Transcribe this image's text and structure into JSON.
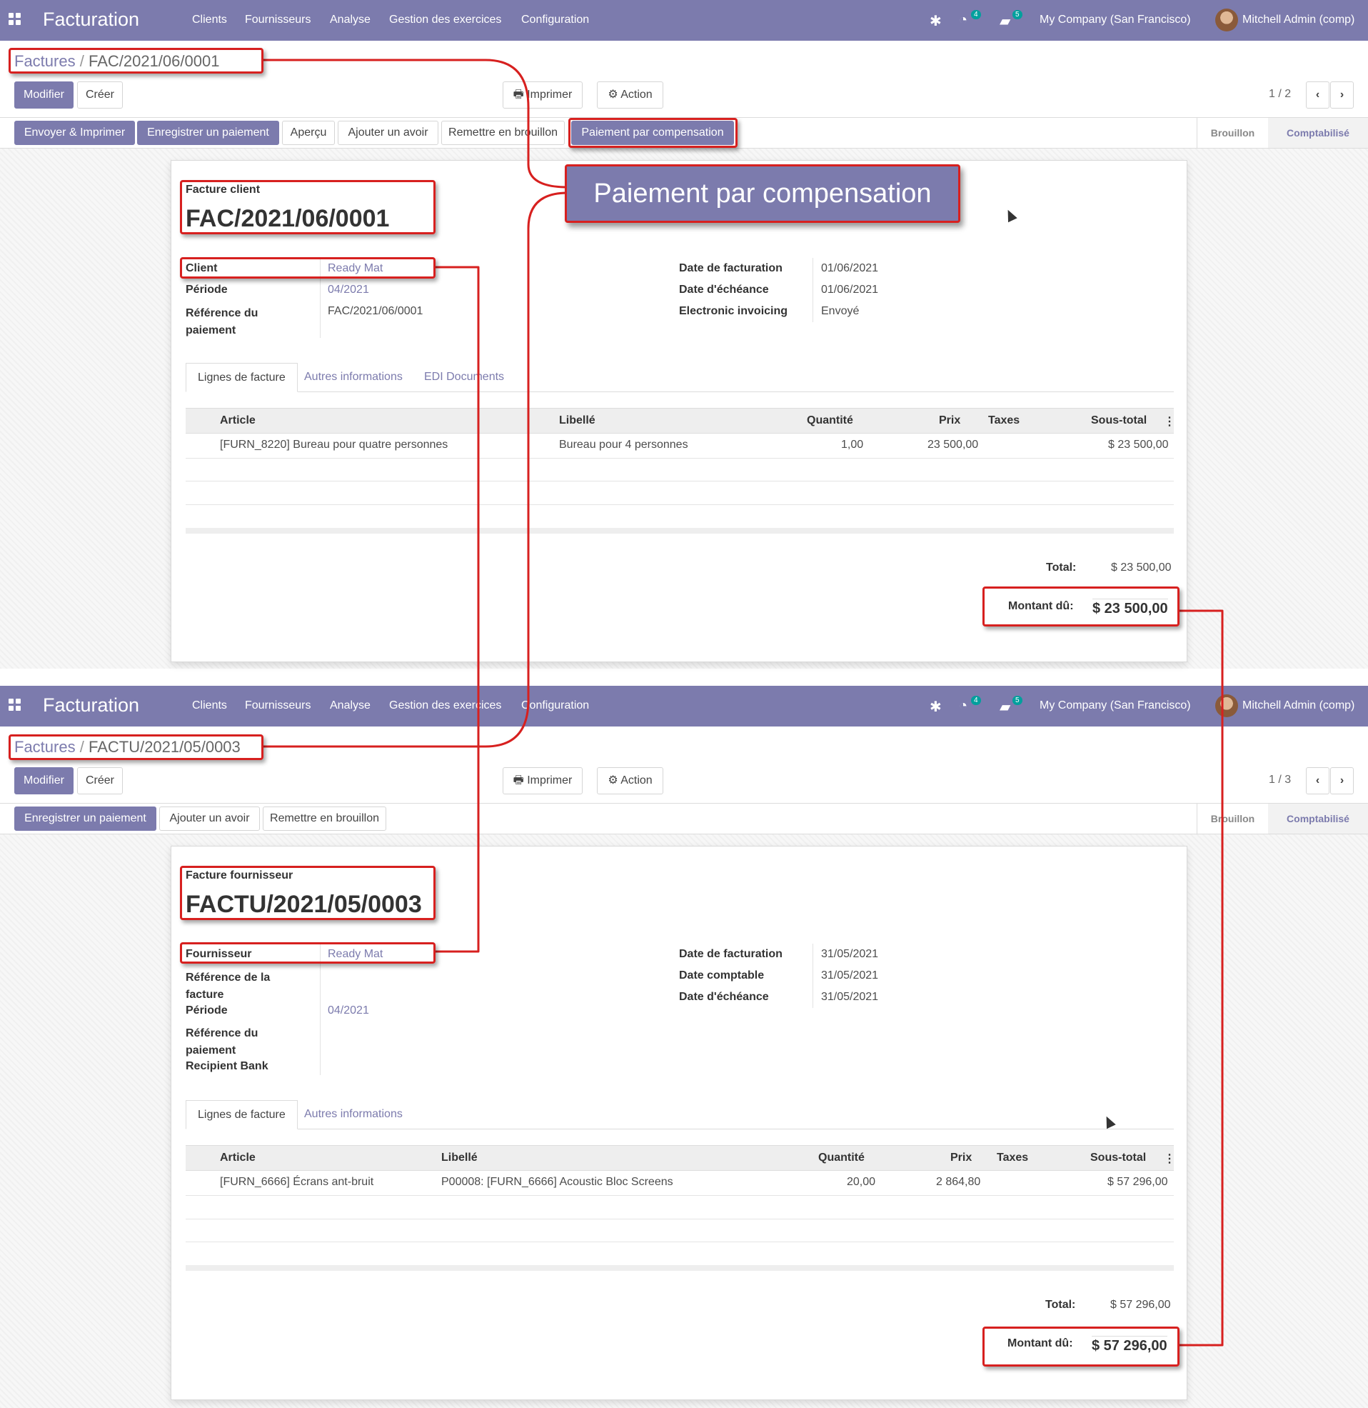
{
  "colors": {
    "brand": "#7c7bad",
    "highlight": "#d7201f",
    "badge": "#00a09d"
  },
  "navbar": {
    "app_name": "Facturation",
    "menu": [
      "Clients",
      "Fournisseurs",
      "Analyse",
      "Gestion des exercices",
      "Configuration"
    ],
    "icons": [
      "bug-icon",
      "activity-icon",
      "chat-icon"
    ],
    "activity_count": "4",
    "message_count": "5",
    "company": "My Company (San Francisco)",
    "user": "Mitchell Admin (comp)"
  },
  "common": {
    "edit": "Modifier",
    "create": "Créer",
    "print": "Imprimer",
    "action": "Action",
    "stage_draft": "Brouillon",
    "stage_posted": "Comptabilisé",
    "tab_lines": "Lignes de facture",
    "tab_other": "Autres informations",
    "tab_edi": "EDI Documents",
    "col_article": "Article",
    "col_label": "Libellé",
    "col_qty": "Quantité",
    "col_price": "Prix",
    "col_taxes": "Taxes",
    "col_subtotal": "Sous-total",
    "total_label": "Total:",
    "due_label": "Montant dû:"
  },
  "callout": "Paiement par compensation",
  "invoice": {
    "breadcrumb_root": "Factures",
    "breadcrumb_sep": "/",
    "breadcrumb_current": "FAC/2021/06/0001",
    "pager": "1 / 2",
    "status_buttons": [
      "Envoyer & Imprimer",
      "Enregistrer un paiement",
      "Aperçu",
      "Ajouter un avoir",
      "Remettre en brouillon",
      "Paiement par compensation"
    ],
    "type_label": "Facture client",
    "number": "FAC/2021/06/0001",
    "partner_label": "Client",
    "partner": "Ready Mat",
    "period_label": "Période",
    "period": "04/2021",
    "payment_ref_label": "Référence du paiement",
    "payment_ref": "FAC/2021/06/0001",
    "date_invoice_label": "Date de facturation",
    "date_invoice": "01/06/2021",
    "date_due_label": "Date d'échéance",
    "date_due": "01/06/2021",
    "einvoice_label": "Electronic invoicing",
    "einvoice": "Envoyé",
    "lines": [
      {
        "article": "[FURN_8220] Bureau pour quatre personnes",
        "label": "Bureau pour 4 personnes",
        "qty": "1,00",
        "price": "23 500,00",
        "taxes": "",
        "subtotal": "$ 23 500,00"
      }
    ],
    "total": "$ 23 500,00",
    "amount_due": "$ 23 500,00"
  },
  "bill": {
    "breadcrumb_root": "Factures",
    "breadcrumb_sep": "/",
    "breadcrumb_current": "FACTU/2021/05/0003",
    "pager": "1 / 3",
    "status_buttons": [
      "Enregistrer un paiement",
      "Ajouter un avoir",
      "Remettre en brouillon"
    ],
    "type_label": "Facture fournisseur",
    "number": "FACTU/2021/05/0003",
    "partner_label": "Fournisseur",
    "partner": "Ready Mat",
    "bill_ref_label": "Référence de la facture",
    "period_label": "Période",
    "period": "04/2021",
    "payment_ref_label": "Référence du paiement",
    "bank_label": "Recipient Bank",
    "date_invoice_label": "Date de facturation",
    "date_invoice": "31/05/2021",
    "date_acc_label": "Date comptable",
    "date_acc": "31/05/2021",
    "date_due_label": "Date d'échéance",
    "date_due": "31/05/2021",
    "lines": [
      {
        "article": "[FURN_6666] Écrans ant-bruit",
        "label": "P00008: [FURN_6666] Acoustic Bloc Screens",
        "qty": "20,00",
        "price": "2 864,80",
        "taxes": "",
        "subtotal": "$ 57 296,00"
      }
    ],
    "total": "$ 57 296,00",
    "amount_due": "$ 57 296,00"
  }
}
